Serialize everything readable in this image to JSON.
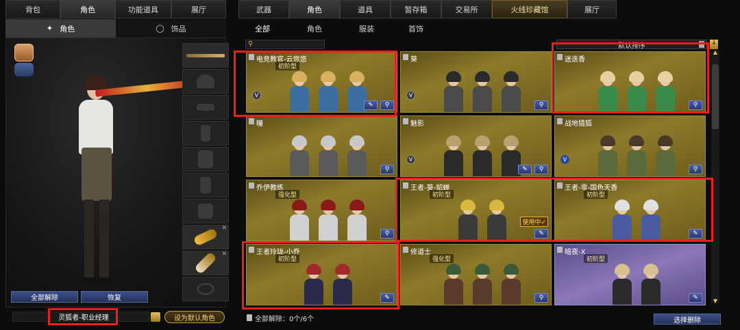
{
  "left_tabs": [
    "背包",
    "角色",
    "功能道具",
    "展厅"
  ],
  "left_subtabs": [
    "角色",
    "饰品"
  ],
  "right_tabs": [
    "武器",
    "角色",
    "道具",
    "暂存箱",
    "交易所",
    "火线珍藏馆",
    "展厅"
  ],
  "right_subtabs": [
    "全部",
    "角色",
    "服装",
    "首饰"
  ],
  "sort_label": "默认排序",
  "left_buttons": {
    "unequip_all": "全部解除",
    "restore": "恢复"
  },
  "current_character": "灵狐者-职业经理",
  "set_default_label": "设为默认角色",
  "bottom_status": "全部解除：0个/6个",
  "select_delete_label": "选择删除",
  "cards": [
    {
      "name": "电竞教官-云悠悠",
      "badge": "初阶型",
      "purple": false
    },
    {
      "name": "葵",
      "badge": "",
      "purple": false
    },
    {
      "name": "迷迭香",
      "badge": "",
      "purple": false
    },
    {
      "name": "瞳",
      "badge": "",
      "purple": false
    },
    {
      "name": "魅影",
      "badge": "",
      "purple": false
    },
    {
      "name": "战地猎狐",
      "badge": "",
      "purple": false
    },
    {
      "name": "乔伊教练",
      "badge": "强化型",
      "purple": false
    },
    {
      "name": "王者-葵-貂蝉",
      "badge": "初阶型",
      "purple": false
    },
    {
      "name": "王者-零-国色天香",
      "badge": "初阶型",
      "purple": false
    },
    {
      "name": "王者玲珑-小乔",
      "badge": "初阶型",
      "purple": false
    },
    {
      "name": "修道士",
      "badge": "强化型",
      "purple": false
    },
    {
      "name": "暗夜-X",
      "badge": "初阶型",
      "purple": true
    }
  ],
  "in_use_label": "使用中✓",
  "colors": {
    "highlight": "#f01d1d",
    "gold_card": "#8d7a2a",
    "purple_card": "#8a78b8",
    "button_blue": "#3b4f87"
  }
}
